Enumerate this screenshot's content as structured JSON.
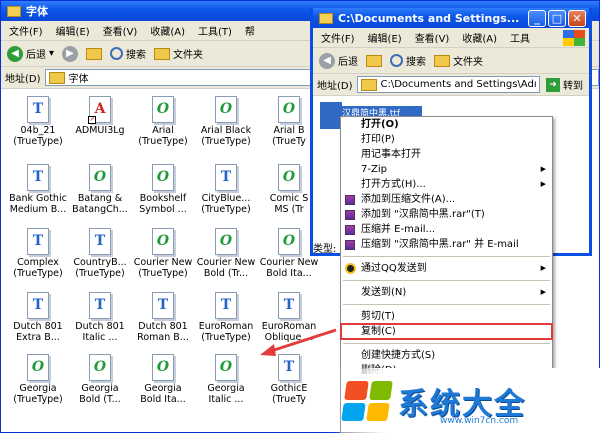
{
  "w1": {
    "title": "字体",
    "menu": [
      "文件(F)",
      "编辑(E)",
      "查看(V)",
      "收藏(A)",
      "工具(T)",
      "帮"
    ],
    "toolbar": {
      "back": "后退",
      "search": "搜索",
      "folders": "文件夹"
    },
    "addr_label": "地址(D)",
    "addr_value": "字体"
  },
  "w2": {
    "title": "C:\\Documents and Settings...",
    "menu": [
      "文件(F)",
      "编辑(E)",
      "查看(V)",
      "收藏(A)",
      "工具"
    ],
    "toolbar": {
      "back": "后退",
      "search": "搜索",
      "folders": "文件夹"
    },
    "addr_label": "地址(D)",
    "addr_value": "C:\\Documents and Settings\\Adı",
    "go": "转到",
    "selected_file": "汉鼎简中黑.ttf",
    "type_label": "类型:"
  },
  "files": [
    {
      "n": "04b_21\n(TrueType)",
      "k": "tt"
    },
    {
      "n": "ADMUI3Lg",
      "k": "ad"
    },
    {
      "n": "Arial\n(TrueType)",
      "k": "ot"
    },
    {
      "n": "Arial Black\n(TrueType)",
      "k": "ot"
    },
    {
      "n": "Arial B\n(TrueTy",
      "k": "ot"
    },
    {
      "n": "Bank Gothic\nMedium B...",
      "k": "tt"
    },
    {
      "n": "Batang &\nBatangCh...",
      "k": "ot"
    },
    {
      "n": "Bookshelf\nSymbol ...",
      "k": "ot"
    },
    {
      "n": "CityBlue...\n(TrueType)",
      "k": "tt"
    },
    {
      "n": "Comic S\nMS (Tr",
      "k": "ot"
    },
    {
      "n": "Complex\n(TrueType)",
      "k": "tt"
    },
    {
      "n": "CountryB...\n(TrueType)",
      "k": "tt"
    },
    {
      "n": "Courier New\n(TrueType)",
      "k": "ot"
    },
    {
      "n": "Courier New\nBold (Tr...",
      "k": "ot"
    },
    {
      "n": "Courier New\nBold Ita...",
      "k": "ot"
    },
    {
      "n": "Dutch 801\nExtra B...",
      "k": "tt"
    },
    {
      "n": "Dutch 801\nItalic ...",
      "k": "tt"
    },
    {
      "n": "Dutch 801\nRoman B...",
      "k": "tt"
    },
    {
      "n": "EuroRoman\n(TrueType)",
      "k": "tt"
    },
    {
      "n": "EuroRoman\nOblique ...",
      "k": "tt"
    },
    {
      "n": "Georgia\n(TrueType)",
      "k": "ot"
    },
    {
      "n": "Georgia\nBold (T...",
      "k": "ot"
    },
    {
      "n": "Georgia\nBold Ita...",
      "k": "ot"
    },
    {
      "n": "Georgia\nItalic ...",
      "k": "ot"
    },
    {
      "n": "GothicE\n(TrueTy",
      "k": "tt"
    }
  ],
  "context_menu": {
    "items": [
      {
        "label": "打开(O)",
        "bold": true
      },
      {
        "label": "打印(P)"
      },
      {
        "label": "用记事本打开"
      },
      {
        "label": "7-Zip",
        "sub": true
      },
      {
        "label": "打开方式(H)...",
        "sub": true
      },
      {
        "label": "添加到压缩文件(A)...",
        "icon": "rar"
      },
      {
        "label": "添加到 \"汉鼎简中黑.rar\"(T)",
        "icon": "rar"
      },
      {
        "label": "压缩并 E-mail...",
        "icon": "rar"
      },
      {
        "label": "压缩到 \"汉鼎简中黑.rar\" 并 E-mail",
        "icon": "rar"
      },
      {
        "sep": true
      },
      {
        "label": "通过QQ发送到",
        "icon": "qq",
        "sub": true
      },
      {
        "sep": true
      },
      {
        "label": "发送到(N)",
        "sub": true
      },
      {
        "sep": true
      },
      {
        "label": "剪切(T)"
      },
      {
        "label": "复制(C)",
        "highlight": true
      },
      {
        "sep": true
      },
      {
        "label": "创建快捷方式(S)"
      },
      {
        "label": "删除(D)"
      }
    ]
  },
  "watermark": {
    "title": "系统大全",
    "url": "www.win7cn.com"
  },
  "colors": {
    "title_blue": "#0b56e8",
    "selection": "#316ac5",
    "highlight_box": "#e23b3b",
    "logo_blue": "#1e7ad6"
  }
}
